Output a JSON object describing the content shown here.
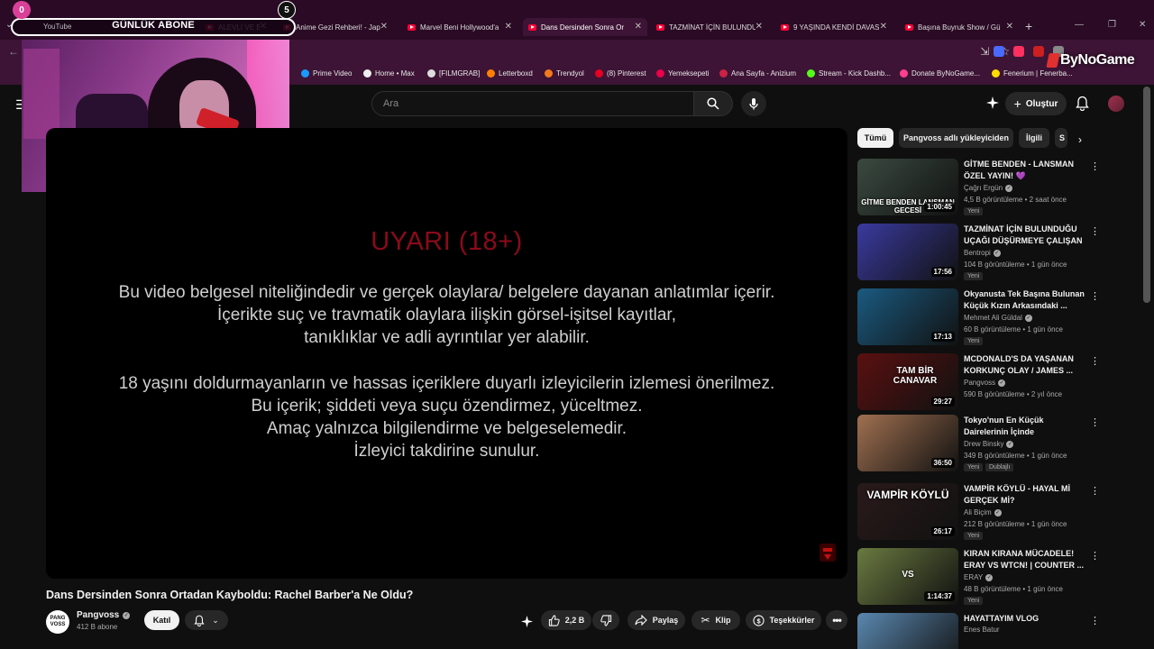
{
  "browser": {
    "tabs": [
      {
        "label": "YouTube",
        "active": false
      },
      {
        "label": "ALEVLİ VE BÖC",
        "active": false
      },
      {
        "label": "Anime Gezi Rehberi! - Jap",
        "active": false
      },
      {
        "label": "Marvel Beni Hollywood'a",
        "active": false
      },
      {
        "label": "Dans Dersinden Sonra Or",
        "active": true
      },
      {
        "label": "TAZMİNAT İÇİN BULUNDU",
        "active": false
      },
      {
        "label": "9 YAŞINDA KENDİ DAVAS",
        "active": false
      },
      {
        "label": "Başına Buyruk Show / Gü",
        "active": false
      }
    ],
    "bookmarks": [
      {
        "label": "Prime Video",
        "color": "#1a98ff"
      },
      {
        "label": "Home • Max",
        "color": "#eeeeee"
      },
      {
        "label": "[FILMGRAB]",
        "color": "#dddddd"
      },
      {
        "label": "Letterboxd",
        "color": "#ff8000"
      },
      {
        "label": "Trendyol",
        "color": "#f27a1a"
      },
      {
        "label": "(8) Pinterest",
        "color": "#e60023"
      },
      {
        "label": "Yemeksepeti",
        "color": "#ea004b"
      },
      {
        "label": "Ana Sayfa - Anizium",
        "color": "#cc2244"
      },
      {
        "label": "Stream - Kick Dashb...",
        "color": "#53fc18"
      },
      {
        "label": "Donate ByNoGame...",
        "color": "#ff4090"
      },
      {
        "label": "Fenerium | Fenerba...",
        "color": "#ffdd00"
      }
    ]
  },
  "overlay": {
    "title": "GÜNLÜK ABONE",
    "count_left": "0",
    "count_right": "5",
    "watermark": "ByNoGame"
  },
  "youtube": {
    "search_placeholder": "Ara",
    "create_label": "Oluştur"
  },
  "player": {
    "warning_title": "UYARI (18+)",
    "paragraph1": [
      "Bu video belgesel niteliğindedir ve gerçek olaylara/ belgelere dayanan anlatımlar içerir.",
      "İçerikte suç ve travmatik olaylara ilişkin görsel-işitsel kayıtlar,",
      "tanıklıklar ve adli ayrıntılar yer alabilir."
    ],
    "paragraph2": [
      "18 yaşını doldurmayanların ve hassas içeriklere duyarlı izleyicilerin izlemesi önerilmez.",
      "Bu içerik; şiddeti veya suçu özendirmez, yüceltmez.",
      "Amaç yalnızca bilgilendirme ve belgeselemedir.",
      "İzleyici takdirine sunulur."
    ]
  },
  "video": {
    "title": "Dans Dersinden Sonra Ortadan Kayboldu: Rachel Barber'a Ne Oldu?",
    "channel": "Pangvoss",
    "channel_avatar_text": "PANG VOSS",
    "subscribers": "412 B abone",
    "join_label": "Katıl",
    "likes": "2,2 B",
    "share_label": "Paylaş",
    "clip_label": "Klip",
    "thanks_label": "Teşekkürler"
  },
  "sidebar": {
    "chips": [
      "Tümü",
      "Pangvoss adlı yükleyiciden",
      "İlgili",
      "S"
    ],
    "recommendations": [
      {
        "title": "GİTME BENDEN - LANSMAN ÖZEL YAYIN! 💜",
        "channel": "Çağrı Ergün",
        "views": "4,5 B görüntüleme",
        "age": "2 saat önce",
        "duration": "1:00:45",
        "badge": "Yeni",
        "thumb_text": "GİTME BENDEN LANSMAN GECESİ",
        "thumb_color": "#3a4a40"
      },
      {
        "title": "TAZMİNAT İÇİN BULUNDUĞU UÇAĞI DÜŞÜRMEYE ÇALIŞAN ...",
        "channel": "Bentropi",
        "views": "104 B görüntüleme",
        "age": "1 gün önce",
        "duration": "17:56",
        "badge": "Yeni",
        "thumb_text": "",
        "thumb_color": "#3a3aa0"
      },
      {
        "title": "Okyanusta Tek Başına Bulunan Küçük Kızın Arkasındaki ...",
        "channel": "Mehmet Ali Güldal",
        "views": "60 B görüntüleme",
        "age": "1 gün önce",
        "duration": "17:13",
        "badge": "Yeni",
        "thumb_text": "",
        "thumb_color": "#1a5a80"
      },
      {
        "title": "MCDONALD'S DA YAŞANAN KORKUNÇ OLAY / JAMES ...",
        "channel": "Pangvoss",
        "views": "590 B görüntüleme",
        "age": "2 yıl önce",
        "duration": "29:27",
        "badge": "",
        "thumb_text": "TAM BİR CANAVAR",
        "thumb_color": "#5a1010"
      },
      {
        "title": "Tokyo'nun En Küçük Dairelerinin İçinde",
        "channel": "Drew Binsky",
        "views": "349 B görüntüleme",
        "age": "1 gün önce",
        "duration": "36:50",
        "badge": "Yeni",
        "dub": "Dublajlı",
        "thumb_text": "",
        "thumb_color": "#a07050"
      },
      {
        "title": "VAMPİR KÖYLÜ - HAYAL Mİ GERÇEK Mİ?",
        "channel": "Ali Biçim",
        "views": "212 B görüntüleme",
        "age": "1 gün önce",
        "duration": "26:17",
        "badge": "Yeni",
        "thumb_text": "VAMPİR KÖYLÜ",
        "thumb_color": "#2a1a1a"
      },
      {
        "title": "KIRAN KIRANA MÜCADELE! ERAY VS WTCN! | COUNTER ...",
        "channel": "ERAY",
        "views": "48 B görüntüleme",
        "age": "1 gün önce",
        "duration": "1:14:37",
        "badge": "Yeni",
        "thumb_text": "VS",
        "thumb_color": "#6a7a40"
      },
      {
        "title": "HAYATTAYIM VLOG",
        "channel": "Enes Batur",
        "views": "",
        "age": "",
        "duration": "",
        "badge": "",
        "thumb_text": "",
        "thumb_color": "#5a88b0"
      }
    ]
  }
}
